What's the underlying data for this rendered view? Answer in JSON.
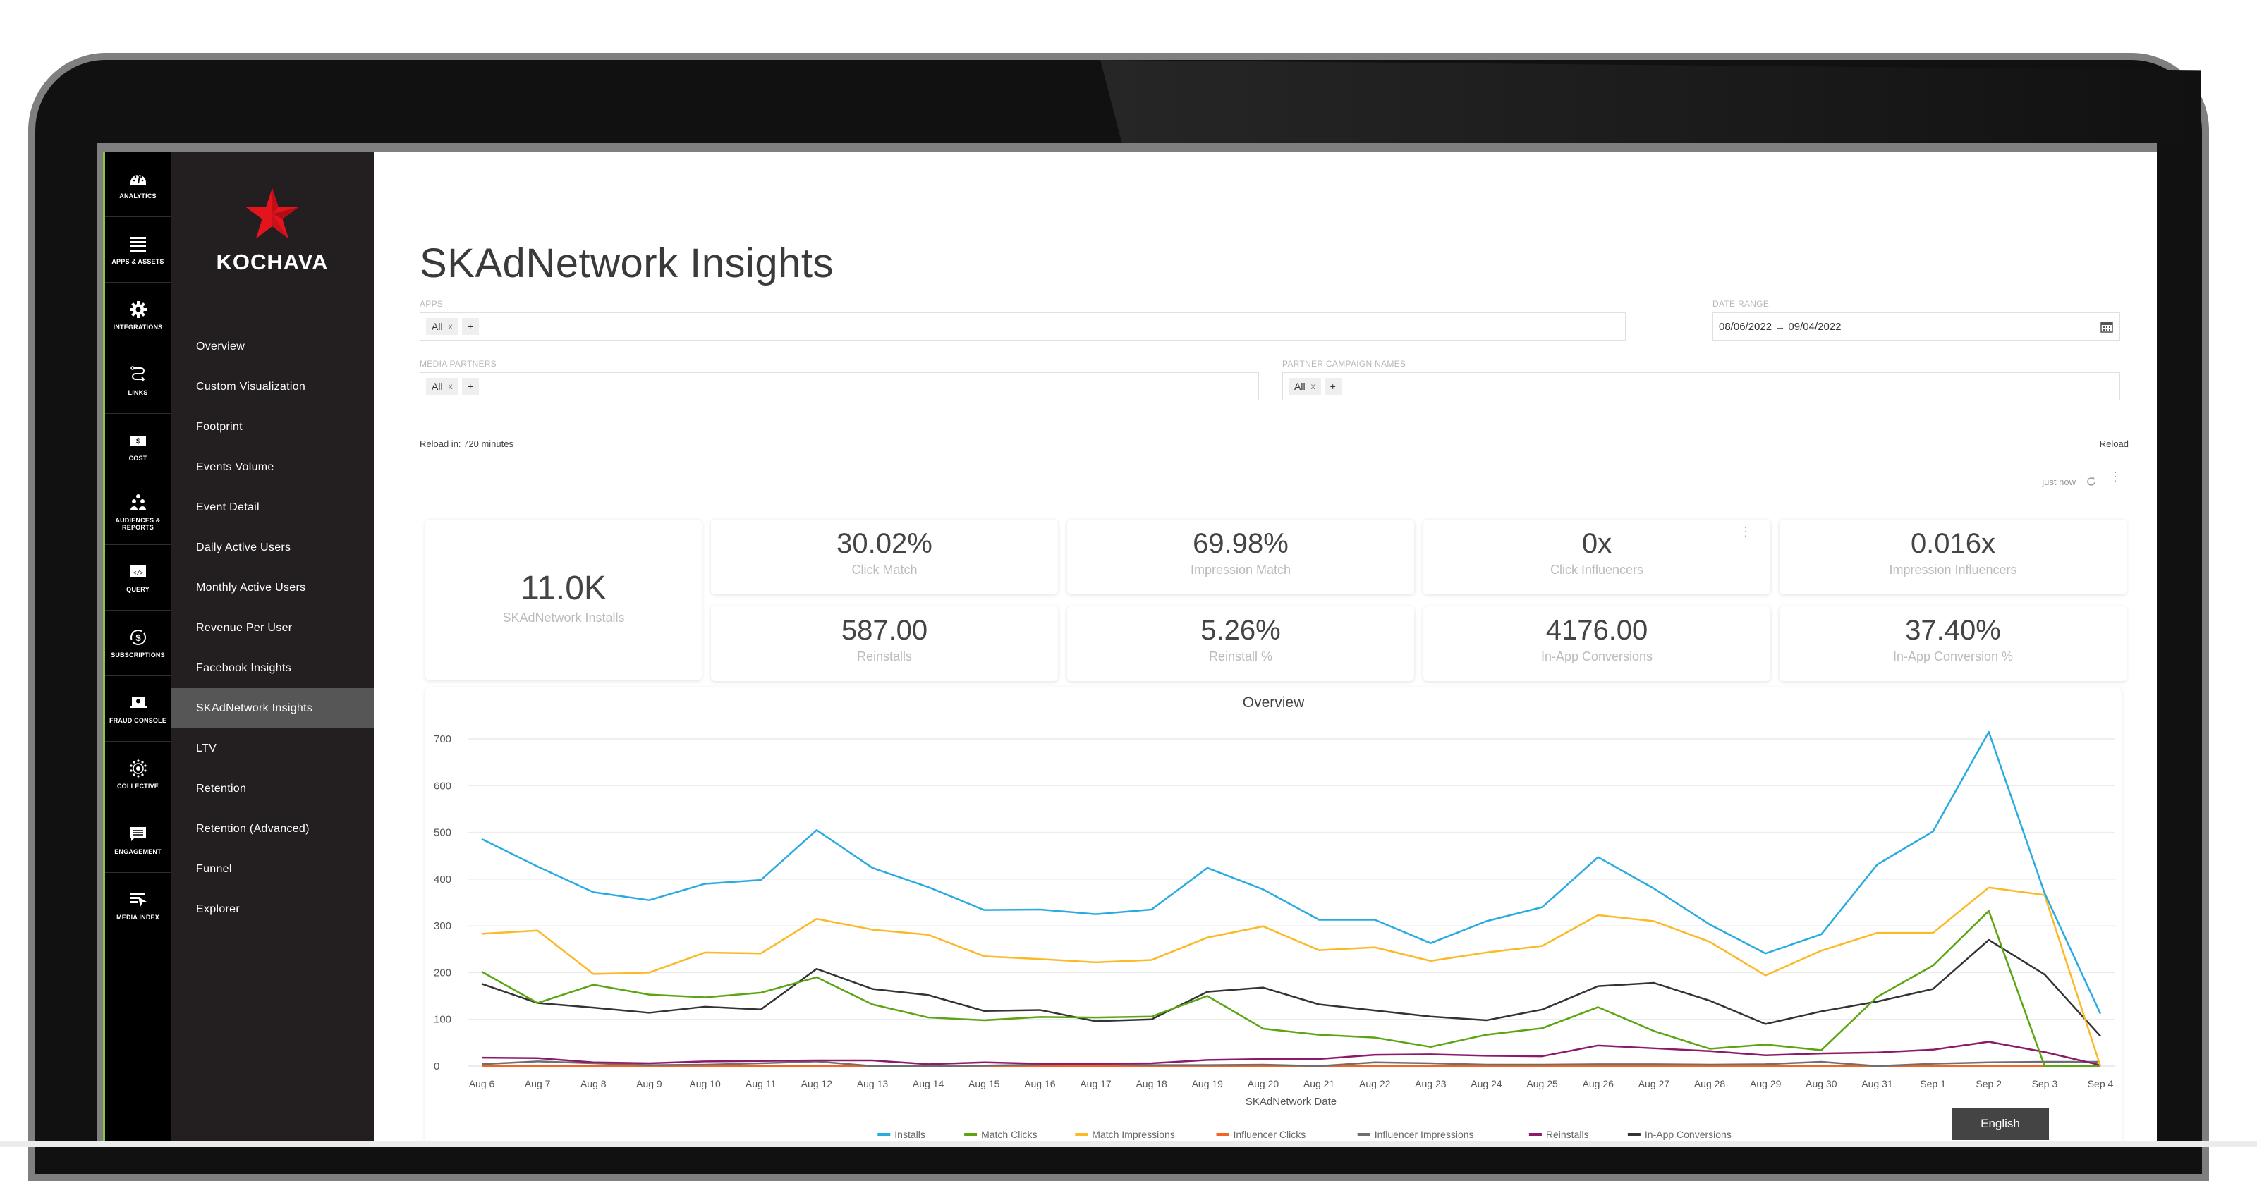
{
  "rail": {
    "items": [
      {
        "label": "ANALYTICS",
        "icon": "speedometer-icon",
        "active": true
      },
      {
        "label": "APPS & ASSETS",
        "icon": "list-icon"
      },
      {
        "label": "INTEGRATIONS",
        "icon": "gear-icon"
      },
      {
        "label": "LINKS",
        "icon": "link-path-icon"
      },
      {
        "label": "COST",
        "icon": "dollar-bill-icon"
      },
      {
        "label": "AUDIENCES & REPORTS",
        "icon": "people-icon"
      },
      {
        "label": "QUERY",
        "icon": "code-window-icon"
      },
      {
        "label": "SUBSCRIPTIONS",
        "icon": "dollar-cycle-icon"
      },
      {
        "label": "FRAUD CONSOLE",
        "icon": "laptop-eye-icon"
      },
      {
        "label": "COLLECTIVE",
        "icon": "dots-circle-icon"
      },
      {
        "label": "ENGAGEMENT",
        "icon": "chat-icon"
      },
      {
        "label": "MEDIA INDEX",
        "icon": "media-cursor-icon"
      }
    ]
  },
  "brand": {
    "name": "KOCHAVA",
    "star_color": "#e3141c"
  },
  "sidebar": {
    "items": [
      {
        "label": "Overview"
      },
      {
        "label": "Custom Visualization"
      },
      {
        "label": "Footprint"
      },
      {
        "label": "Events Volume"
      },
      {
        "label": "Event Detail"
      },
      {
        "label": "Daily Active Users"
      },
      {
        "label": "Monthly Active Users"
      },
      {
        "label": "Revenue Per User"
      },
      {
        "label": "Facebook Insights"
      },
      {
        "label": "SKAdNetwork Insights",
        "active": true
      },
      {
        "label": "LTV"
      },
      {
        "label": "Retention"
      },
      {
        "label": "Retention (Advanced)"
      },
      {
        "label": "Funnel"
      },
      {
        "label": "Explorer"
      }
    ]
  },
  "page": {
    "title": "SKAdNetwork Insights",
    "filters": {
      "apps": {
        "label": "APPS",
        "chip": "All",
        "remove": "x",
        "add": "+"
      },
      "date_range": {
        "label": "DATE RANGE",
        "value": "08/06/2022 → 09/04/2022"
      },
      "media_partners": {
        "label": "MEDIA PARTNERS",
        "chip": "All",
        "remove": "x",
        "add": "+"
      },
      "partner_campaign_names": {
        "label": "PARTNER CAMPAIGN NAMES",
        "chip": "All",
        "remove": "x",
        "add": "+"
      }
    },
    "reload_in": "Reload in: 720 minutes",
    "reload": "Reload",
    "updated": "just now"
  },
  "kpis": {
    "main": {
      "value": "11.0K",
      "label": "SKAdNetwork Installs"
    },
    "cards": [
      {
        "value": "30.02%",
        "label": "Click Match"
      },
      {
        "value": "69.98%",
        "label": "Impression Match"
      },
      {
        "value": "0x",
        "label": "Click Influencers"
      },
      {
        "value": "0.016x",
        "label": "Impression Influencers"
      },
      {
        "value": "587.00",
        "label": "Reinstalls"
      },
      {
        "value": "5.26%",
        "label": "Reinstall %"
      },
      {
        "value": "4176.00",
        "label": "In-App Conversions"
      },
      {
        "value": "37.40%",
        "label": "In-App Conversion %"
      }
    ]
  },
  "language": "English",
  "chart_data": {
    "type": "line",
    "title": "Overview",
    "xlabel": "SKAdNetwork Date",
    "ylabel": "",
    "ylim": [
      0,
      700
    ],
    "yticks": [
      0,
      100,
      200,
      300,
      400,
      500,
      600,
      700
    ],
    "grid": true,
    "legend": "bottom",
    "categories": [
      "Aug 6",
      "Aug 7",
      "Aug 8",
      "Aug 9",
      "Aug 10",
      "Aug 11",
      "Aug 12",
      "Aug 13",
      "Aug 14",
      "Aug 15",
      "Aug 16",
      "Aug 17",
      "Aug 18",
      "Aug 19",
      "Aug 20",
      "Aug 21",
      "Aug 22",
      "Aug 23",
      "Aug 24",
      "Aug 25",
      "Aug 26",
      "Aug 27",
      "Aug 28",
      "Aug 29",
      "Aug 30",
      "Aug 31",
      "Sep 1",
      "Sep 2",
      "Sep 3",
      "Sep 4"
    ],
    "series": [
      {
        "name": "Installs",
        "color": "#29abe2",
        "values": [
          486,
          427,
          372,
          355,
          390,
          398,
          505,
          424,
          383,
          334,
          335,
          325,
          335,
          424,
          378,
          313,
          313,
          263,
          310,
          340,
          447,
          380,
          303,
          241,
          282,
          431,
          502,
          715,
          370,
          112
        ]
      },
      {
        "name": "Match Clicks",
        "color": "#5ba412",
        "values": [
          202,
          135,
          174,
          153,
          147,
          157,
          190,
          132,
          104,
          98,
          105,
          104,
          106,
          150,
          80,
          67,
          61,
          41,
          67,
          81,
          126,
          75,
          37,
          46,
          34,
          148,
          215,
          332,
          0,
          0
        ]
      },
      {
        "name": "Match Impressions",
        "color": "#fbb926",
        "values": [
          283,
          290,
          197,
          200,
          243,
          241,
          315,
          292,
          281,
          235,
          229,
          222,
          227,
          275,
          299,
          248,
          254,
          225,
          243,
          257,
          323,
          310,
          266,
          194,
          247,
          285,
          285,
          382,
          366,
          0
        ]
      },
      {
        "name": "Influencer Clicks",
        "color": "#f26522",
        "values": [
          0,
          0,
          0,
          0,
          0,
          0,
          0,
          0,
          0,
          0,
          0,
          0,
          0,
          0,
          0,
          0,
          0,
          0,
          0,
          0,
          0,
          0,
          0,
          0,
          0,
          0,
          0,
          0,
          0,
          0
        ]
      },
      {
        "name": "Influencer Impressions",
        "color": "#6d6e71",
        "values": [
          4,
          10,
          6,
          2,
          3,
          6,
          10,
          0,
          0,
          1,
          3,
          4,
          2,
          2,
          3,
          0,
          8,
          6,
          3,
          3,
          4,
          4,
          3,
          4,
          9,
          0,
          5,
          8,
          9,
          9
        ]
      },
      {
        "name": "Reinstalls",
        "color": "#8b1a6b",
        "values": [
          18,
          17,
          8,
          6,
          10,
          11,
          12,
          12,
          4,
          8,
          5,
          5,
          6,
          13,
          15,
          15,
          24,
          25,
          22,
          21,
          44,
          38,
          32,
          23,
          27,
          29,
          35,
          52,
          30,
          2
        ]
      },
      {
        "name": "In-App Conversions",
        "color": "#333333",
        "values": [
          176,
          135,
          125,
          114,
          127,
          121,
          208,
          165,
          152,
          118,
          120,
          96,
          100,
          159,
          168,
          132,
          119,
          106,
          98,
          121,
          171,
          178,
          140,
          90,
          117,
          138,
          165,
          270,
          196,
          64
        ]
      }
    ]
  }
}
